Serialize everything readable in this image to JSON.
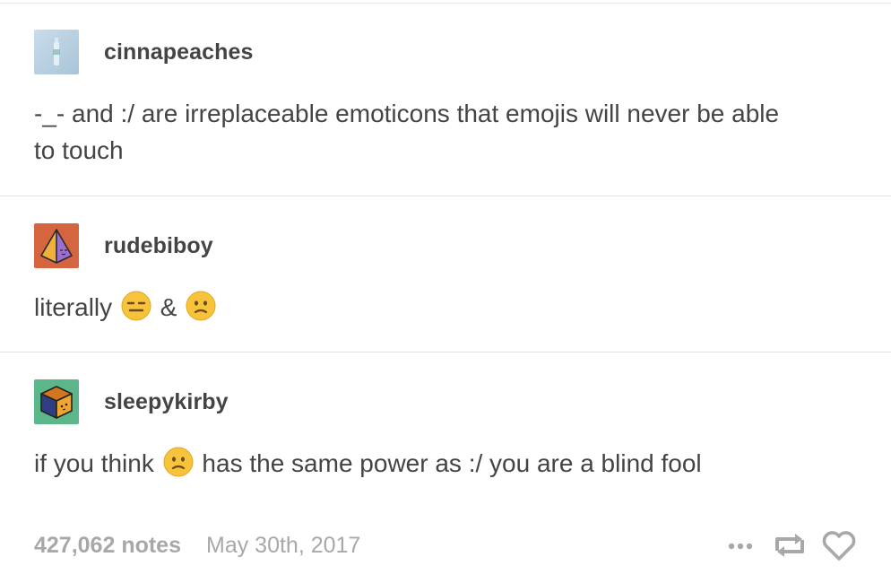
{
  "posts": [
    {
      "username": "cinnapeaches",
      "avatar_icon": "cinnapeaches-avatar",
      "text_line1": "-_- and :/ are irreplaceable emoticons that emojis will never be able",
      "text_line2": "to touch"
    },
    {
      "username": "rudebiboy",
      "avatar_icon": "pyramid-avatar",
      "text_before": "literally",
      "emoji1": "expressionless-face-icon",
      "text_mid": "&",
      "emoji2": "confused-face-icon"
    },
    {
      "username": "sleepykirby",
      "avatar_icon": "cube-avatar",
      "text_before": "if you think",
      "emoji1": "confused-face-icon",
      "text_after": "has the same power as :/ you are a blind fool"
    }
  ],
  "footer": {
    "notes": "427,062 notes",
    "date": "May 30th, 2017",
    "icons": [
      "more-icon",
      "reblog-icon",
      "heart-icon"
    ]
  },
  "colors": {
    "text": "#444444",
    "muted": "#a8a8a8",
    "divider": "#e2e2e2",
    "emoji_yellow": "#f7c33b"
  }
}
